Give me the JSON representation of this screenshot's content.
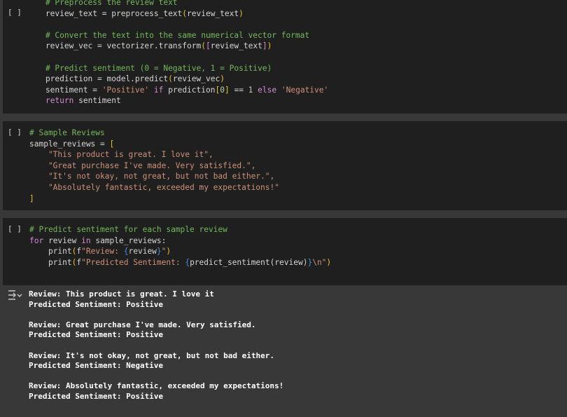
{
  "cells": [
    {
      "bracket": "[ ]",
      "lines": [
        "    # Preprocess the review text",
        "    review_text = preprocess_text(review_text)",
        "",
        "    # Convert the text into the same numerical vector format",
        "    review_vec = vectorizer.transform([review_text])",
        "",
        "    # Predict sentiment (0 = Negative, 1 = Positive)",
        "    prediction = model.predict(review_vec)",
        "    sentiment = 'Positive' if prediction[0] == 1 else 'Negative'",
        "    return sentiment"
      ]
    },
    {
      "bracket": "[ ]",
      "lines": [
        "# Sample Reviews",
        "sample_reviews = [",
        "    \"This product is great. I love it\",",
        "    \"Great purchase I've made. Very satisfied.\",",
        "    \"It's not okay, not great, but not bad either.\",",
        "    \"Absolutely fantastic, exceeded my expectations!\"",
        "]"
      ]
    },
    {
      "bracket": "[ ]",
      "lines": [
        "# Predict sentiment for each sample review",
        "for review in sample_reviews:",
        "    print(f\"Review: {review}\")",
        "    print(f\"Predicted Sentiment: {predict_sentiment(review)}\\n\")"
      ]
    }
  ],
  "output": {
    "icon": "output-toggle-icon",
    "lines": [
      "Review: This product is great. I love it",
      "Predicted Sentiment: Positive",
      "",
      "Review: Great purchase I've made. Very satisfied.",
      "Predicted Sentiment: Positive",
      "",
      "Review: It's not okay, not great, but not bad either.",
      "Predicted Sentiment: Negative",
      "",
      "Review: Absolutely fantastic, exceeded my expectations!",
      "Predicted Sentiment: Positive"
    ]
  }
}
